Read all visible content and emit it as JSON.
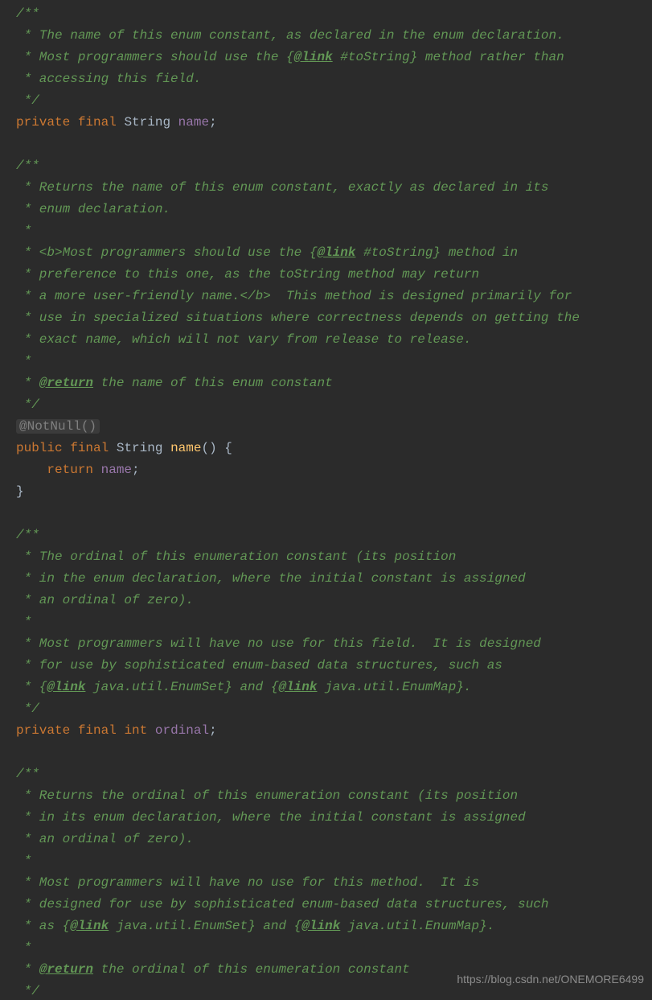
{
  "watermark": "https://blog.csdn.net/ONEMORE6499",
  "code": {
    "doc1_l1": "/**",
    "doc1_l2": " * The name of this enum constant, as declared in the enum declaration.",
    "doc1_l3a": " * Most programmers should use the {",
    "doc1_l3_link": "@link",
    "doc1_l3b": " #toString} method rather than",
    "doc1_l4": " * accessing this field.",
    "doc1_l5": " */",
    "decl1_private": "private",
    "decl1_final": "final",
    "decl1_type": "String",
    "decl1_name": "name",
    "semicolon": ";",
    "doc2_l1": "/**",
    "doc2_l2": " * Returns the name of this enum constant, exactly as declared in its",
    "doc2_l3": " * enum declaration.",
    "doc2_l4": " *",
    "doc2_l5a": " * <b>Most programmers should use the {",
    "doc2_l5_link": "@link",
    "doc2_l5b": " #toString} method in",
    "doc2_l6": " * preference to this one, as the toString method may return",
    "doc2_l7": " * a more user-friendly name.</b>  This method is designed primarily for",
    "doc2_l8": " * use in specialized situations where correctness depends on getting the",
    "doc2_l9": " * exact name, which will not vary from release to release.",
    "doc2_l10": " *",
    "doc2_l11a": " * ",
    "doc2_l11_tag": "@return",
    "doc2_l11b": " the name of this enum constant",
    "doc2_l12": " */",
    "anno_notnull": "@NotNull()",
    "meth1_public": "public",
    "meth1_final": "final",
    "meth1_type": "String",
    "meth1_name": "name",
    "meth1_parens": "()",
    "space": " ",
    "brace_open": "{",
    "meth1_indent": "    ",
    "meth1_return_kw": "return",
    "meth1_return_id": "name",
    "brace_close": "}",
    "doc3_l1": "/**",
    "doc3_l2": " * The ordinal of this enumeration constant (its position",
    "doc3_l3": " * in the enum declaration, where the initial constant is assigned",
    "doc3_l4": " * an ordinal of zero).",
    "doc3_l5": " *",
    "doc3_l6": " * Most programmers will have no use for this field.  It is designed",
    "doc3_l7": " * for use by sophisticated enum-based data structures, such as",
    "doc3_l8a": " * {",
    "doc3_l8_link1": "@link",
    "doc3_l8b": " java.util.EnumSet} and {",
    "doc3_l8_link2": "@link",
    "doc3_l8c": " java.util.EnumMap}.",
    "doc3_l9": " */",
    "decl2_private": "private",
    "decl2_final": "final",
    "decl2_type": "int",
    "decl2_name": "ordinal",
    "doc4_l1": "/**",
    "doc4_l2": " * Returns the ordinal of this enumeration constant (its position",
    "doc4_l3": " * in its enum declaration, where the initial constant is assigned",
    "doc4_l4": " * an ordinal of zero).",
    "doc4_l5": " *",
    "doc4_l6": " * Most programmers will have no use for this method.  It is",
    "doc4_l7": " * designed for use by sophisticated enum-based data structures, such",
    "doc4_l8a": " * as {",
    "doc4_l8_link1": "@link",
    "doc4_l8b": " java.util.EnumSet} and {",
    "doc4_l8_link2": "@link",
    "doc4_l8c": " java.util.EnumMap}.",
    "doc4_l9": " *",
    "doc4_l10a": " * ",
    "doc4_l10_tag": "@return",
    "doc4_l10b": " the ordinal of this enumeration constant",
    "doc4_l11": " */"
  }
}
